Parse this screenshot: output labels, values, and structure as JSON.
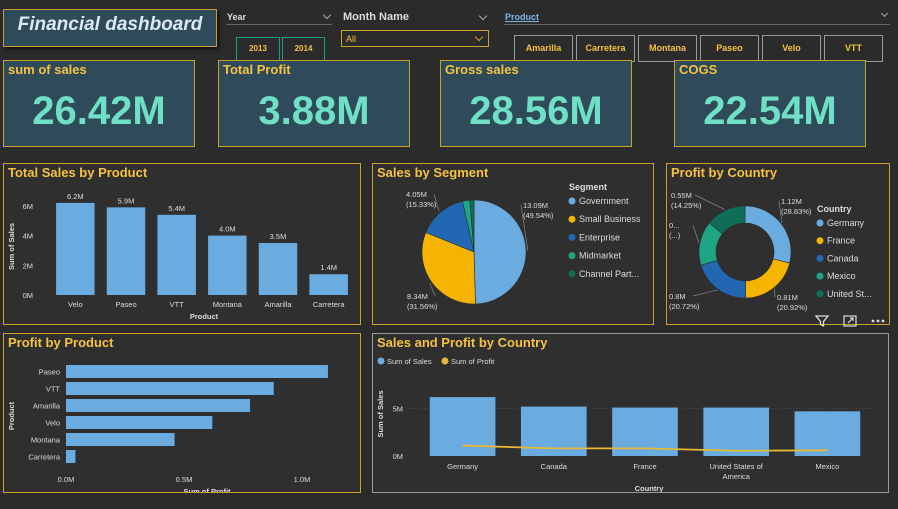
{
  "title": "Financial dashboard",
  "slicers": {
    "year": {
      "label": "Year",
      "options": [
        "2013",
        "2014"
      ]
    },
    "month": {
      "label": "Month Name",
      "value": "All"
    },
    "product": {
      "label": "Product",
      "options": [
        "Amarilla",
        "Carretera",
        "Montana",
        "Paseo",
        "Velo",
        "VTT"
      ]
    }
  },
  "kpis": [
    {
      "label": "sum of sales",
      "value": "26.42M"
    },
    {
      "label": "Total Profit",
      "value": "3.88M"
    },
    {
      "label": "Gross sales",
      "value": "28.56M"
    },
    {
      "label": "COGS",
      "value": "22.54M"
    }
  ],
  "icons": {
    "filter": "filter-icon",
    "focus": "focus-mode-icon",
    "more": "more-options-icon"
  },
  "colors": {
    "bar": "#6aabe0",
    "accent": "#f5c242",
    "kpi_value": "#6fe0c6",
    "kpi_bg": "#2f4b5a",
    "line": "#e8b934"
  },
  "chart_data": [
    {
      "id": "sales_by_product",
      "type": "bar",
      "title": "Total Sales by Product",
      "xlabel": "Product",
      "ylabel": "Sum of Sales",
      "categories": [
        "Velo",
        "Paseo",
        "VTT",
        "Montana",
        "Amarilla",
        "Carretera"
      ],
      "values": [
        6.2,
        5.9,
        5.4,
        4.0,
        3.5,
        1.4
      ],
      "data_labels": [
        "6.2M",
        "5.9M",
        "5.4M",
        "4.0M",
        "3.5M",
        "1.4M"
      ],
      "yticks": [
        "0M",
        "2M",
        "4M",
        "6M"
      ],
      "ylim": [
        0,
        6.8
      ]
    },
    {
      "id": "sales_by_segment",
      "type": "pie",
      "title": "Sales by Segment",
      "legend_title": "Segment",
      "labels": [
        "Government",
        "Small Business",
        "Enterprise",
        "Midmarket",
        "Channel Part..."
      ],
      "values": [
        13.09,
        8.34,
        4.05,
        0.6,
        0.34
      ],
      "colors": [
        "#6aabe0",
        "#f5b400",
        "#2167b1",
        "#1ea684",
        "#0e6e58"
      ],
      "data_labels": [
        "13.09M\n(49.54%)",
        "8.34M\n(31.56%)",
        "4.05M\n(15.33%)",
        "",
        ""
      ]
    },
    {
      "id": "profit_by_country",
      "type": "pie",
      "subtype": "donut",
      "title": "Profit by Country",
      "legend_title": "Country",
      "labels": [
        "Germany",
        "France",
        "Canada",
        "Mexico",
        "United St..."
      ],
      "values": [
        1.12,
        0.81,
        0.8,
        0.6,
        0.55
      ],
      "colors": [
        "#6aabe0",
        "#f5b400",
        "#2167b1",
        "#1ea684",
        "#0e6e58"
      ],
      "data_labels": [
        "1.12M\n(28.83%)",
        "0.81M\n(20.92%)",
        "0.8M\n(20.72%)",
        "0...\n(...)",
        "0.55M\n(14.25%)"
      ]
    },
    {
      "id": "profit_by_product",
      "type": "bar",
      "orientation": "horizontal",
      "title": "Profit by Product",
      "xlabel": "Sum of Profit",
      "ylabel": "Product",
      "categories": [
        "Paseo",
        "VTT",
        "Amarilla",
        "Velo",
        "Montana",
        "Carretera"
      ],
      "values": [
        1.11,
        0.88,
        0.78,
        0.62,
        0.46,
        0.04
      ],
      "xticks": [
        "0.0M",
        "0.5M",
        "1.0M"
      ],
      "xlim": [
        0,
        1.0
      ]
    },
    {
      "id": "sales_profit_by_country",
      "type": "bar",
      "title": "Sales and Profit by Country",
      "xlabel": "Country",
      "ylabel": "Sum of Sales",
      "categories": [
        "Germany",
        "Canada",
        "France",
        "United States of America",
        "Mexico"
      ],
      "series": [
        {
          "name": "Sum of  Sales",
          "type": "bar",
          "values": [
            6.2,
            5.2,
            5.1,
            5.1,
            4.7
          ]
        },
        {
          "name": "Sum of Profit",
          "type": "line",
          "values": [
            1.1,
            0.8,
            0.8,
            0.55,
            0.6
          ]
        }
      ],
      "yticks": [
        "0M",
        "5M"
      ],
      "ylim": [
        0,
        8
      ]
    }
  ]
}
